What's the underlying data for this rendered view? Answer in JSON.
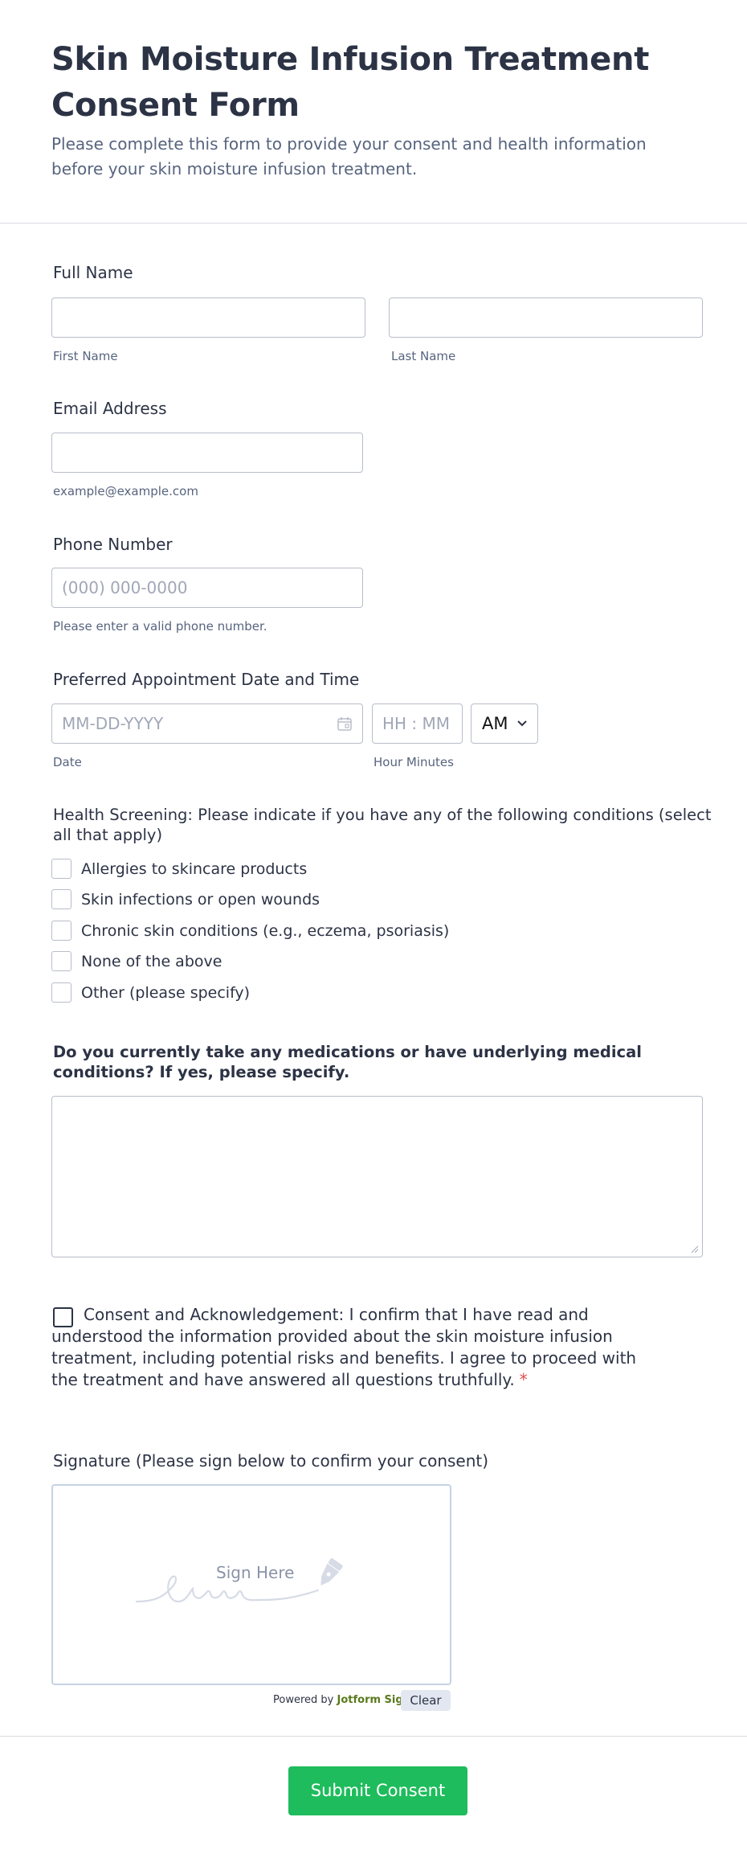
{
  "header": {
    "title": "Skin Moisture Infusion Treatment Consent Form",
    "subtitle": "Please complete this form to provide your consent and health information before your skin moisture infusion treatment."
  },
  "full_name": {
    "label": "Full Name",
    "first_value": "",
    "last_value": "",
    "first_sublabel": "First Name",
    "last_sublabel": "Last Name"
  },
  "email": {
    "label": "Email Address",
    "value": "",
    "sublabel": "example@example.com"
  },
  "phone": {
    "label": "Phone Number",
    "placeholder": "(000) 000-0000",
    "sublabel": "Please enter a valid phone number."
  },
  "appointment": {
    "label": "Preferred Appointment Date and Time",
    "date_placeholder": "MM-DD-YYYY",
    "time_placeholder": "HH : MM",
    "ampm_value": "AM",
    "date_sublabel": "Date",
    "time_sublabel": "Hour Minutes"
  },
  "health": {
    "label": "Health Screening: Please indicate if you have any of the following conditions (select all that apply)",
    "options": [
      "Allergies to skincare products",
      "Skin infections or open wounds",
      "Chronic skin conditions (e.g., eczema, psoriasis)",
      "None of the above",
      "Other (please specify)"
    ]
  },
  "medications": {
    "label": "Do you currently take any medications or have underlying medical conditions? If yes, please specify.",
    "value": ""
  },
  "consent": {
    "text": "Consent and Acknowledgement: I confirm that I have read and understood the information provided about the skin moisture infusion treatment, including potential risks and benefits. I agree to proceed with the treatment and have answered all questions truthfully.",
    "required_mark": "*"
  },
  "signature": {
    "label": "Signature (Please sign below to confirm your consent)",
    "sign_here": "Sign Here",
    "powered_by": "Powered by",
    "brand": "Jotform Sign",
    "clear_label": "Clear"
  },
  "submit": {
    "label": "Submit Consent"
  },
  "colors": {
    "submit_green": "#1ebc5c",
    "required_red": "#e34c4c",
    "brand_green": "#5a7a1c"
  }
}
